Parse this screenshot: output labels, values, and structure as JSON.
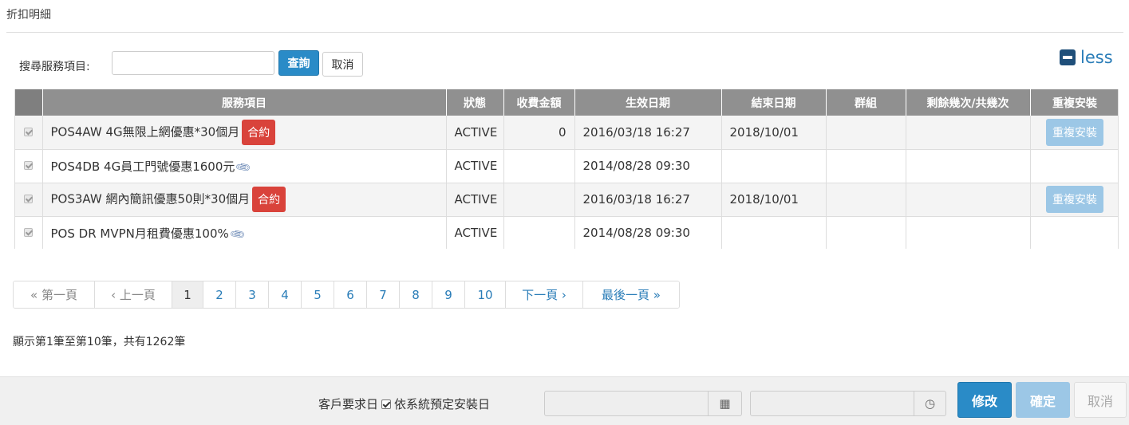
{
  "section": {
    "title": "折扣明細"
  },
  "search": {
    "label": "搜尋服務項目:",
    "value": "",
    "placeholder": "",
    "query_label": "查詢",
    "cancel_label": "取消"
  },
  "toggle": {
    "label": "less"
  },
  "table": {
    "headers": [
      "",
      "服務項目",
      "狀態",
      "收費金額",
      "生效日期",
      "結束日期",
      "群組",
      "剩餘幾次/共幾次",
      "重複安裝"
    ],
    "rows": [
      {
        "checked": true,
        "service": "POS4AW 4G無限上網優惠*30個月",
        "badge": "合約",
        "attachment": false,
        "status": "ACTIVE",
        "amount": "0",
        "start": "2016/03/18 16:27",
        "end": "2018/10/01",
        "group": "",
        "remaining": "",
        "reinstall": "重複安裝"
      },
      {
        "checked": true,
        "service": "POS4DB 4G員工門號優惠1600元",
        "badge": "",
        "attachment": true,
        "status": "ACTIVE",
        "amount": "",
        "start": "2014/08/28 09:30",
        "end": "",
        "group": "",
        "remaining": "",
        "reinstall": ""
      },
      {
        "checked": true,
        "service": "POS3AW 網內簡訊優惠50則*30個月",
        "badge": "合約",
        "attachment": false,
        "status": "ACTIVE",
        "amount": "",
        "start": "2016/03/18 16:27",
        "end": "2018/10/01",
        "group": "",
        "remaining": "",
        "reinstall": "重複安裝"
      },
      {
        "checked": true,
        "service": "POS DR MVPN月租費優惠100%",
        "badge": "",
        "attachment": true,
        "status": "ACTIVE",
        "amount": "",
        "start": "2014/08/28 09:30",
        "end": "",
        "group": "",
        "remaining": "",
        "reinstall": ""
      }
    ]
  },
  "pagination": {
    "first": "« 第一頁",
    "prev": "‹ 上一頁",
    "pages": [
      "1",
      "2",
      "3",
      "4",
      "5",
      "6",
      "7",
      "8",
      "9",
      "10"
    ],
    "current": "1",
    "next": "下一頁 ›",
    "last": "最後一頁 »"
  },
  "summary": "顯示第1筆至第10筆，共有1262筆",
  "footer": {
    "request_label": "客戶要求日",
    "system_label": "依系統預定安裝日",
    "system_checked": true,
    "date_value": "",
    "time_value": "",
    "modify_label": "修改",
    "confirm_label": "確定",
    "cancel_label": "取消"
  },
  "icons": {
    "calendar": "calendar-icon",
    "clock": "clock-icon",
    "attachment": "paperclip-icon",
    "collapse": "minus-square-icon"
  },
  "colors": {
    "primary": "#2a8bc7",
    "primary_disabled": "#9cc7e6",
    "contract_badge": "#d9433b",
    "header_bg": "#909090"
  }
}
